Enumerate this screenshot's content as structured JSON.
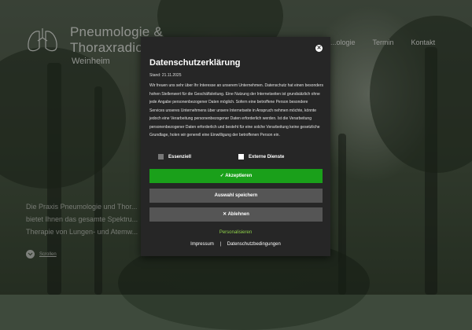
{
  "site": {
    "title_line1": "Pneumologie &",
    "title_line2": "Thoraxradio",
    "subtitle": "Weinheim",
    "nav": [
      "...ologie",
      "Termin",
      "Kontakt"
    ],
    "intro_lines": [
      "Die Praxis Pneumologie und Thor...",
      "bietet Ihnen das gesamte Spektru...",
      "Therapie von Lungen- und Atemw..."
    ],
    "scroll_label": "Scrollen"
  },
  "consent": {
    "title": "Datenschutzerklärung",
    "date": "Stand: 21.11.2025",
    "text": "Wir freuen uns sehr über Ihr Interesse an unserem Unternehmen. Datenschutz hat einen besonders hohen Stellenwert für die Geschäftsleitung. Eine Nutzung der Internetseiten ist grundsätzlich ohne jede Angabe personenbezogener Daten möglich. Sofern eine betroffene Person besondere Services unseres Unternehmens über unsere Internetseite in Anspruch nehmen möchte, könnte jedoch eine Verarbeitung personenbezogener Daten erforderlich werden. Ist die Verarbeitung personenbezogener Daten erforderlich und besteht für eine solche Verarbeitung keine gesetzliche Grundlage, holen wir generell eine Einwilligung der betroffenen Person ein.",
    "option_essential": "Essenziell",
    "option_external": "Externe Dienste",
    "accept": "✓ Akzeptieren",
    "save": "Auswahl speichern",
    "reject": "✕ Ablehnen",
    "personalize": "Personalisieren",
    "link_imprint": "Impressum",
    "link_separator": "|",
    "link_privacy": "Datenschutzbedingungen",
    "close_symbol": "✕"
  },
  "colors": {
    "accept_green": "#1aa01a",
    "modal_bg": "#262626",
    "button_gray": "#555555",
    "personalize_link": "#8fd14a"
  }
}
